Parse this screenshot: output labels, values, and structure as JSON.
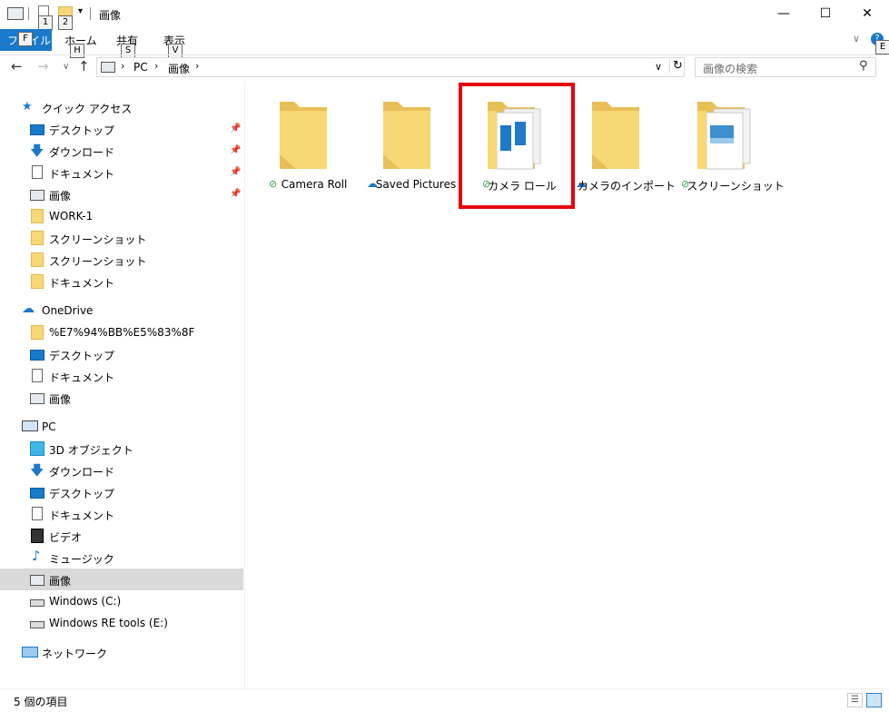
{
  "window": {
    "title": "画像",
    "qa_badges": [
      "1",
      "2"
    ],
    "ribbon_badge": "E"
  },
  "ribbon": {
    "file_tab": "ファイル",
    "file_key": "F",
    "tabs": [
      {
        "label": "ホーム",
        "key": "H"
      },
      {
        "label": "共有",
        "key": "S"
      },
      {
        "label": "表示",
        "key": "V"
      }
    ]
  },
  "address": {
    "crumbs": [
      "PC",
      "画像"
    ],
    "search_placeholder": "画像の検索"
  },
  "sidebar": {
    "quick_access": {
      "label": "クイック アクセス",
      "items": [
        "デスクトップ",
        "ダウンロード",
        "ドキュメント",
        "画像",
        "WORK-1",
        "スクリーンショット",
        "スクリーンショット",
        "ドキュメント"
      ]
    },
    "onedrive": {
      "label": "OneDrive",
      "items": [
        "%E7%94%BB%E5%83%8F",
        "デスクトップ",
        "ドキュメント",
        "画像"
      ]
    },
    "pc": {
      "label": "PC",
      "items": [
        "3D オブジェクト",
        "ダウンロード",
        "デスクトップ",
        "ドキュメント",
        "ビデオ",
        "ミュージック",
        "画像",
        "Windows (C:)",
        "Windows RE tools (E:)"
      ]
    },
    "network": {
      "label": "ネットワーク"
    }
  },
  "folders": [
    {
      "name": "Camera Roll",
      "status": "synced"
    },
    {
      "name": "Saved Pictures",
      "status": "cloud"
    },
    {
      "name": "カメラ ロール",
      "status": "synced"
    },
    {
      "name": "カメラのインポート",
      "status": "cloud"
    },
    {
      "name": "スクリーンショット",
      "status": "synced"
    }
  ],
  "status": {
    "item_count": "5 個の項目"
  },
  "colors": {
    "accent": "#1979ca",
    "highlight": "#e8000d",
    "folder": "#f8d775",
    "synced": "#36a04a",
    "cloud": "#1979ca"
  }
}
